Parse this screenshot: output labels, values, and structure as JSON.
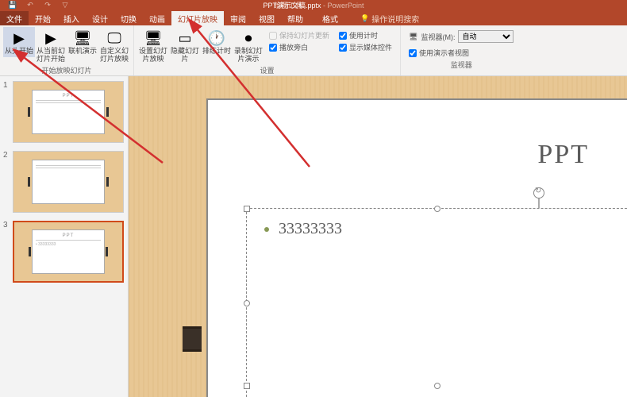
{
  "app_title": "PPT演示文稿.pptx",
  "app_name": "PowerPoint",
  "drawing_tools": "绘图工具",
  "tabs": {
    "file": "文件",
    "home": "开始",
    "insert": "插入",
    "design": "设计",
    "transitions": "切换",
    "animations": "动画",
    "slideshow": "幻灯片放映",
    "review": "审阅",
    "view": "视图",
    "help": "帮助",
    "format": "格式"
  },
  "help_search": "操作说明搜索",
  "ribbon": {
    "group_start": {
      "from_beginning": "从头开始",
      "from_current": "从当前幻灯片开始",
      "online": "联机演示",
      "custom": "自定义幻灯片放映",
      "label": "开始放映幻灯片"
    },
    "group_setup": {
      "setup": "设置幻灯片放映",
      "hide": "隐藏幻灯片",
      "rehearse": "排练计时",
      "record": "录制幻灯片演示",
      "keep_timings": "保持幻灯片更新",
      "use_timings": "使用计时",
      "narrations": "播放旁白",
      "media_controls": "显示媒体控件",
      "label": "设置"
    },
    "group_monitors": {
      "monitor_label": "监视器(M):",
      "monitor_value": "自动",
      "presenter_view": "使用演示者视图",
      "label": "监视器"
    }
  },
  "slides": [
    {
      "num": "1",
      "title": "PPT",
      "body": ""
    },
    {
      "num": "2",
      "title": "",
      "body": ""
    },
    {
      "num": "3",
      "title": "PPT",
      "body": "• 33333333"
    }
  ],
  "editor": {
    "title": "PPT",
    "bullet": "33333333"
  }
}
